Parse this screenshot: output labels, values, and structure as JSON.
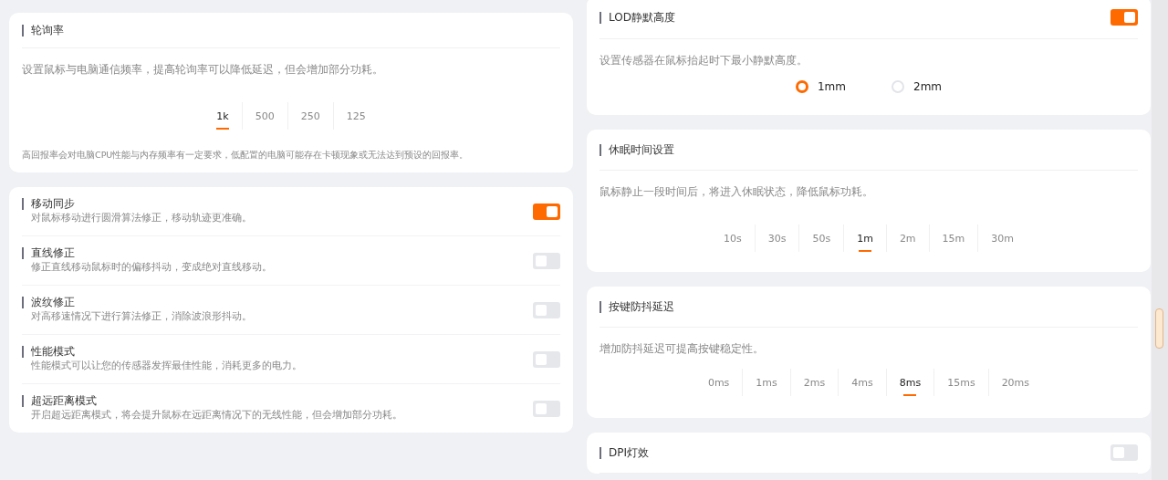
{
  "polling": {
    "title": "轮询率",
    "description": "设置鼠标与电脑通信频率，提高轮询率可以降低延迟，但会增加部分功耗。",
    "options": [
      {
        "label": "1k",
        "selected": true
      },
      {
        "label": "500",
        "selected": false
      },
      {
        "label": "250",
        "selected": false
      },
      {
        "label": "125",
        "selected": false
      }
    ],
    "note": "高回报率会对电脑CPU性能与内存频率有一定要求，低配置的电脑可能存在卡顿现象或无法达到预设的回报率。"
  },
  "toggles": [
    {
      "title": "移动同步",
      "description": "对鼠标移动进行圆滑算法修正，移动轨迹更准确。",
      "on": true
    },
    {
      "title": "直线修正",
      "description": "修正直线移动鼠标时的偏移抖动，变成绝对直线移动。",
      "on": false
    },
    {
      "title": "波纹修正",
      "description": "对高移速情况下进行算法修正，消除波浪形抖动。",
      "on": false
    },
    {
      "title": "性能模式",
      "description": "性能模式可以让您的传感器发挥最佳性能，消耗更多的电力。",
      "on": false
    },
    {
      "title": "超远距离模式",
      "description": "开启超远距离模式，将会提升鼠标在远距离情况下的无线性能，但会增加部分功耗。",
      "on": false
    }
  ],
  "lod": {
    "title": "LOD静默高度",
    "on": true,
    "description": "设置传感器在鼠标抬起时下最小静默高度。",
    "options": [
      {
        "label": "1mm",
        "selected": true
      },
      {
        "label": "2mm",
        "selected": false
      }
    ]
  },
  "sleep": {
    "title": "休眠时间设置",
    "description": "鼠标静止一段时间后，将进入休眠状态，降低鼠标功耗。",
    "options": [
      {
        "label": "10s",
        "selected": false
      },
      {
        "label": "30s",
        "selected": false
      },
      {
        "label": "50s",
        "selected": false
      },
      {
        "label": "1m",
        "selected": true
      },
      {
        "label": "2m",
        "selected": false
      },
      {
        "label": "15m",
        "selected": false
      },
      {
        "label": "30m",
        "selected": false
      }
    ]
  },
  "debounce": {
    "title": "按键防抖延迟",
    "description": "增加防抖延迟可提高按键稳定性。",
    "options": [
      {
        "label": "0ms",
        "selected": false
      },
      {
        "label": "1ms",
        "selected": false
      },
      {
        "label": "2ms",
        "selected": false
      },
      {
        "label": "4ms",
        "selected": false
      },
      {
        "label": "8ms",
        "selected": true
      },
      {
        "label": "15ms",
        "selected": false
      },
      {
        "label": "20ms",
        "selected": false
      }
    ]
  },
  "dpi_light": {
    "title": "DPI灯效",
    "on": false
  }
}
